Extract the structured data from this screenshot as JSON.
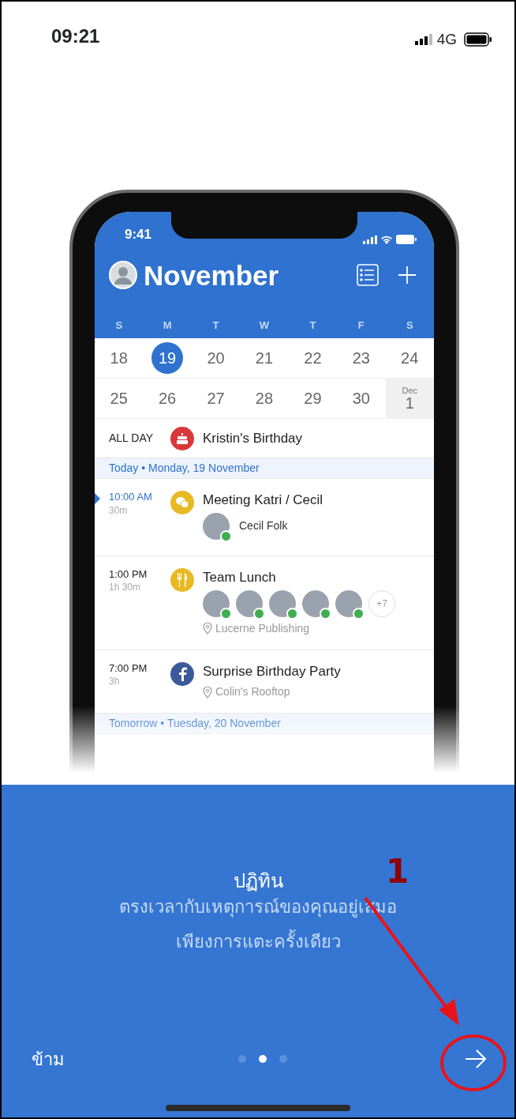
{
  "status_bar": {
    "time": "09:21",
    "network": "4G"
  },
  "phone": {
    "status_time": "9:41",
    "month": "November",
    "weekdays": [
      "S",
      "M",
      "T",
      "W",
      "T",
      "F",
      "S"
    ],
    "weeks": [
      [
        {
          "day": "18",
          "selected": false
        },
        {
          "day": "19",
          "selected": true
        },
        {
          "day": "20",
          "selected": false
        },
        {
          "day": "21",
          "selected": false
        },
        {
          "day": "22",
          "selected": false
        },
        {
          "day": "23",
          "selected": false
        },
        {
          "day": "24",
          "selected": false
        }
      ],
      [
        {
          "day": "25",
          "selected": false
        },
        {
          "day": "26",
          "selected": false
        },
        {
          "day": "27",
          "selected": false
        },
        {
          "day": "28",
          "selected": false
        },
        {
          "day": "29",
          "selected": false
        },
        {
          "day": "30",
          "selected": false
        },
        {
          "month": "Dec",
          "day": "1",
          "selected": false
        }
      ]
    ],
    "all_day": {
      "label": "ALL DAY",
      "title": "Kristin's Birthday",
      "kind": "birthday",
      "color": "#d9383a"
    },
    "sections": [
      {
        "header": "Today • Monday, 19 November",
        "events": [
          {
            "time": "10:00 AM",
            "duration": "30m",
            "current": true,
            "kind": "meeting",
            "color": "#e8b923",
            "title": "Meeting Katri / Cecil",
            "attendees": [
              {
                "accepted": true
              }
            ],
            "attendee_name": "Cecil Folk"
          },
          {
            "time": "1:00 PM",
            "duration": "1h 30m",
            "current": false,
            "kind": "lunch",
            "color": "#e8b923",
            "title": "Team Lunch",
            "attendees": [
              {
                "accepted": true
              },
              {
                "accepted": true
              },
              {
                "accepted": true
              },
              {
                "accepted": true
              },
              {
                "accepted": true
              }
            ],
            "more": "+7",
            "location": "Lucerne Publishing"
          },
          {
            "time": "7:00 PM",
            "duration": "3h",
            "current": false,
            "kind": "facebook",
            "color": "#3b5a9a",
            "title": "Surprise Birthday Party",
            "location": "Colin's Rooftop"
          }
        ]
      },
      {
        "header": "Tomorrow • Tuesday, 20 November"
      }
    ]
  },
  "onboarding": {
    "title": "ปฏิทิน",
    "description": [
      "ตรงเวลากับเหตุการณ์ของคุณอยู่เสมอ",
      "เพียงการแตะครั้งเดียว"
    ],
    "skip": "ข้าม",
    "pages": [
      {
        "selected": false
      },
      {
        "selected": true
      },
      {
        "selected": false
      }
    ]
  },
  "annotation": {
    "label": "1"
  }
}
